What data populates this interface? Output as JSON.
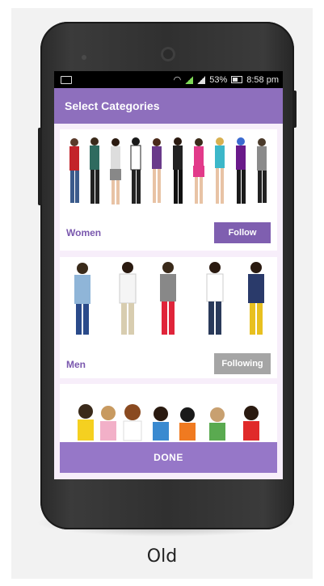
{
  "status": {
    "battery": "53%",
    "time": "8:58 pm"
  },
  "appbar": {
    "title": "Select Categories"
  },
  "categories": [
    {
      "label": "Women",
      "button": "Follow"
    },
    {
      "label": "Men",
      "button": "Following"
    },
    {
      "label": "",
      "button": ""
    }
  ],
  "done_label": "DONE",
  "caption": "Old",
  "colors": {
    "accent": "#8e6fbd",
    "button": "#7f5fb0",
    "following": "#a5a5a5",
    "list_bg": "#f7eefa"
  },
  "icons": [
    "notification-icon",
    "wifi-icon",
    "signal-icon",
    "battery-icon"
  ]
}
